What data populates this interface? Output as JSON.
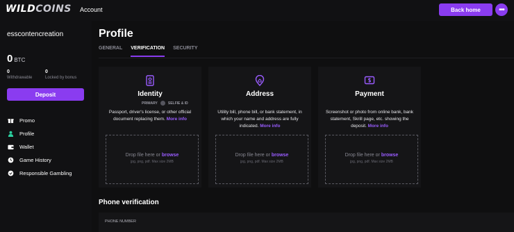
{
  "header": {
    "logo": [
      "WILD",
      "COINS"
    ],
    "account_label": "Account",
    "back_home_label": "Back home",
    "more_label": "•••"
  },
  "sidebar": {
    "username": "esscontencreation",
    "balance": "0",
    "currency": "BTC",
    "withdrawable_value": "0",
    "withdrawable_label": "Withdrawable",
    "locked_value": "0",
    "locked_label": "Locked by bonus",
    "deposit_label": "Deposit",
    "menu": [
      {
        "label": "Promo",
        "icon": "promo-icon"
      },
      {
        "label": "Profile",
        "icon": "user-icon"
      },
      {
        "label": "Wallet",
        "icon": "wallet-icon"
      },
      {
        "label": "Game History",
        "icon": "history-icon"
      },
      {
        "label": "Responsible Gambling",
        "icon": "shield-icon"
      }
    ]
  },
  "main": {
    "title": "Profile",
    "tabs": [
      "GENERAL",
      "VERIFICATION",
      "SECURITY"
    ],
    "active_tab": "VERIFICATION",
    "cards": [
      {
        "title": "Identity",
        "primary": "PRIMARY",
        "selfie": "SELFIE & ID",
        "desc": "Passport, driver's license, or other official document replacing them.",
        "more": "More info",
        "drop": "Drop file here or",
        "browse": "browse",
        "formats": "jpg, png, pdf. Max size 2MB"
      },
      {
        "title": "Address",
        "desc": "Utility bill, phone bill, or bank statement, in which your name and address are fully indicated.",
        "more": "More info",
        "drop": "Drop file here or",
        "browse": "browse",
        "formats": "jpg, png, pdf. Max size 2MB"
      },
      {
        "title": "Payment",
        "desc": "Screenshot or photo from online bank, bank statement, Skrill page, etc. showing the deposit.",
        "more": "More info",
        "drop": "Drop file here or",
        "browse": "browse",
        "formats": "jpg, png, pdf. Max size 2MB"
      }
    ],
    "phone_title": "Phone verification",
    "phone_label": "PHONE NUMBER"
  },
  "colors": {
    "accent": "#8a3cf0",
    "active_icon": "#2cd1a0",
    "background": "#0f0f10"
  }
}
